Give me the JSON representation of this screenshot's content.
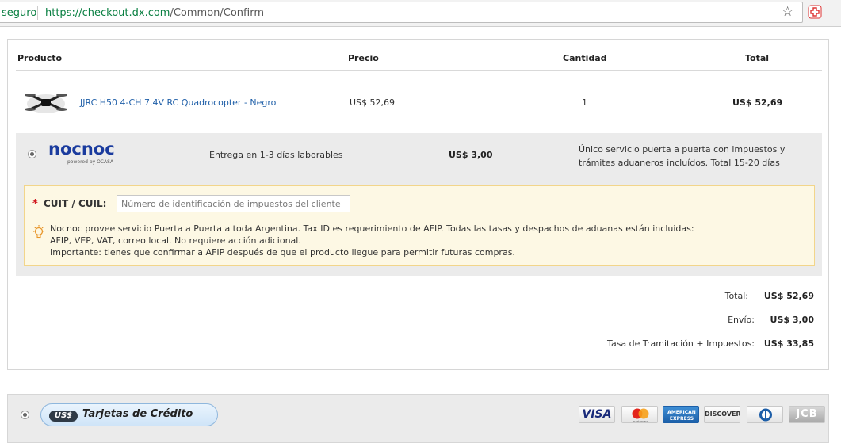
{
  "browser": {
    "secure_label": "seguro",
    "url_scheme_host": "https://checkout.dx.com",
    "url_path": "/Common/Confirm"
  },
  "table": {
    "headers": [
      "Producto",
      "Precio",
      "Cantidad",
      "Total"
    ],
    "product": {
      "name": "JJRC H50 4-CH 7.4V RC Quadrocopter - Negro",
      "price": "US$ 52,69",
      "quantity": "1",
      "total": "US$ 52,69"
    }
  },
  "shipping": {
    "logo_text": "nocnoc",
    "logo_powered": "powered by OCASA",
    "delivery": "Entrega en 1-3 días laborables",
    "price": "US$ 3,00",
    "description": "Único servicio puerta a puerta con impuestos y trámites aduaneros incluídos. Total 15-20 días"
  },
  "cuit": {
    "required_mark": "*",
    "label": "CUIT / CUIL:",
    "placeholder": "Número de identificación de impuestos del cliente",
    "value": "",
    "notice_lines": [
      "Nocnoc provee servicio Puerta a Puerta a toda Argentina. Tax ID es requerimiento de AFIP. Todas las tasas y despachos de aduanas están incluidas:",
      "AFIP, VEP, VAT, correo local. No requiere acción adicional.",
      "Importante: tienes que confirmar a AFIP después de que el producto llegue para permitir futuras compras."
    ]
  },
  "totals": {
    "total_label": "Total:",
    "total_value": "US$ 52,69",
    "shipping_label": "Envío:",
    "shipping_value": "US$ 3,00",
    "tax_label": "Tasa de Tramitación + Impuestos:",
    "tax_value": "US$ 33,85"
  },
  "payment": {
    "badge": "US$",
    "title": "Tarjetas de Crédito",
    "cards": [
      "VISA",
      "MasterCard",
      "American Express",
      "DISCOVER",
      "Diners Club",
      "JCB"
    ]
  },
  "colors": {
    "link": "#1f5fa8",
    "secure_green": "#0b8043",
    "nocnoc_blue": "#1a3b9e",
    "required_red": "#d0141b"
  }
}
